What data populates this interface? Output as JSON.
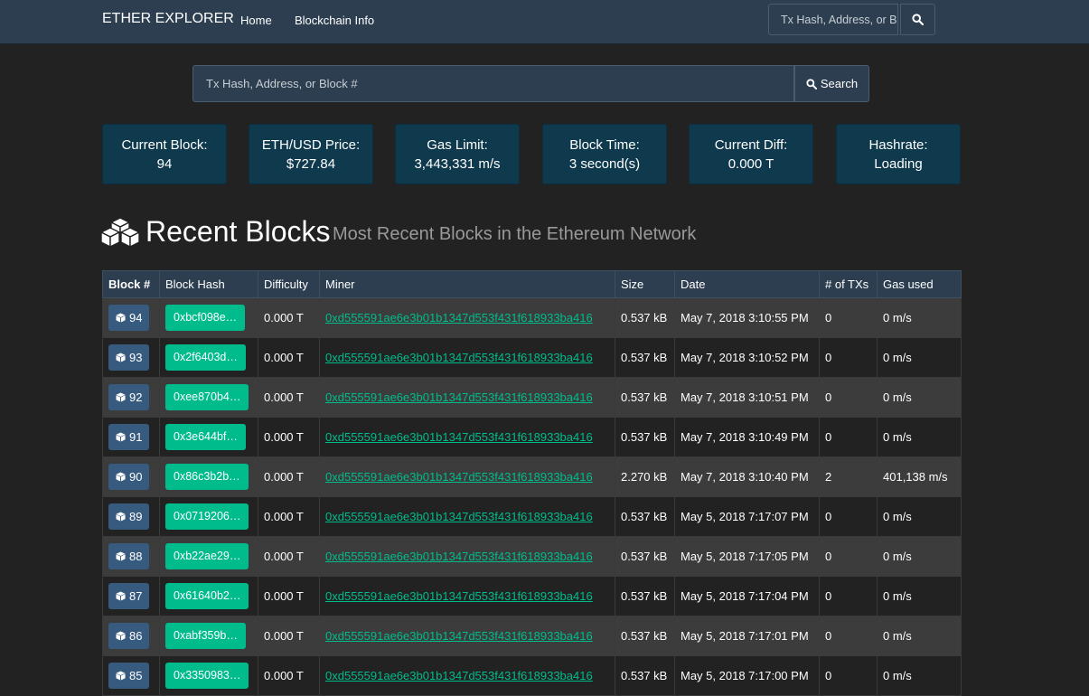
{
  "navbar": {
    "brand": "ETHER EXPLORER",
    "links": [
      "Home",
      "Blockchain Info"
    ],
    "search_placeholder": "Tx Hash, Address, or Block #"
  },
  "search": {
    "placeholder": "Tx Hash, Address, or Block #",
    "button_label": "Search"
  },
  "stats": [
    {
      "label": "Current Block:",
      "value": "94"
    },
    {
      "label": "ETH/USD Price:",
      "value": "$727.84"
    },
    {
      "label": "Gas Limit:",
      "value": "3,443,331 m/s"
    },
    {
      "label": "Block Time:",
      "value": "3 second(s)"
    },
    {
      "label": "Current Diff:",
      "value": "0.000 T"
    },
    {
      "label": "Hashrate:",
      "value": "Loading"
    }
  ],
  "section": {
    "title": "Recent Blocks",
    "subtitle": "Most Recent Blocks in the Ethereum Network"
  },
  "table": {
    "headers": [
      "Block #",
      "Block Hash",
      "Difficulty",
      "Miner",
      "Size",
      "Date",
      "# of TXs",
      "Gas used"
    ],
    "rows": [
      {
        "block": "94",
        "hash": "0xbcf098e…",
        "difficulty": "0.000 T",
        "miner": "0xd555591ae6e3b01b1347d553f431f618933ba416",
        "size": "0.537 kB",
        "date": "May 7, 2018 3:10:55 PM",
        "txs": "0",
        "gas": "0 m/s"
      },
      {
        "block": "93",
        "hash": "0x2f6403d…",
        "difficulty": "0.000 T",
        "miner": "0xd555591ae6e3b01b1347d553f431f618933ba416",
        "size": "0.537 kB",
        "date": "May 7, 2018 3:10:52 PM",
        "txs": "0",
        "gas": "0 m/s"
      },
      {
        "block": "92",
        "hash": "0xee870b4…",
        "difficulty": "0.000 T",
        "miner": "0xd555591ae6e3b01b1347d553f431f618933ba416",
        "size": "0.537 kB",
        "date": "May 7, 2018 3:10:51 PM",
        "txs": "0",
        "gas": "0 m/s"
      },
      {
        "block": "91",
        "hash": "0x3e644bf…",
        "difficulty": "0.000 T",
        "miner": "0xd555591ae6e3b01b1347d553f431f618933ba416",
        "size": "0.537 kB",
        "date": "May 7, 2018 3:10:49 PM",
        "txs": "0",
        "gas": "0 m/s"
      },
      {
        "block": "90",
        "hash": "0x86c3b2b…",
        "difficulty": "0.000 T",
        "miner": "0xd555591ae6e3b01b1347d553f431f618933ba416",
        "size": "2.270 kB",
        "date": "May 7, 2018 3:10:40 PM",
        "txs": "2",
        "gas": "401,138 m/s"
      },
      {
        "block": "89",
        "hash": "0x0719206…",
        "difficulty": "0.000 T",
        "miner": "0xd555591ae6e3b01b1347d553f431f618933ba416",
        "size": "0.537 kB",
        "date": "May 5, 2018 7:17:07 PM",
        "txs": "0",
        "gas": "0 m/s"
      },
      {
        "block": "88",
        "hash": "0xb22ae29…",
        "difficulty": "0.000 T",
        "miner": "0xd555591ae6e3b01b1347d553f431f618933ba416",
        "size": "0.537 kB",
        "date": "May 5, 2018 7:17:05 PM",
        "txs": "0",
        "gas": "0 m/s"
      },
      {
        "block": "87",
        "hash": "0x61640b2…",
        "difficulty": "0.000 T",
        "miner": "0xd555591ae6e3b01b1347d553f431f618933ba416",
        "size": "0.537 kB",
        "date": "May 5, 2018 7:17:04 PM",
        "txs": "0",
        "gas": "0 m/s"
      },
      {
        "block": "86",
        "hash": "0xabf359b…",
        "difficulty": "0.000 T",
        "miner": "0xd555591ae6e3b01b1347d553f431f618933ba416",
        "size": "0.537 kB",
        "date": "May 5, 2018 7:17:01 PM",
        "txs": "0",
        "gas": "0 m/s"
      },
      {
        "block": "85",
        "hash": "0x3350983…",
        "difficulty": "0.000 T",
        "miner": "0xd555591ae6e3b01b1347d553f431f618933ba416",
        "size": "0.537 kB",
        "date": "May 5, 2018 7:17:00 PM",
        "txs": "0",
        "gas": "0 m/s"
      }
    ]
  },
  "colors": {
    "background": "#222222",
    "navbar": "#2c3e50",
    "stat_card": "#0f3a4e",
    "block_button": "#375a7f",
    "hash_button": "#00bc8c",
    "link": "#00bc8c"
  },
  "icons": {
    "search": "search-icon",
    "blocks": "cubes-icon",
    "block": "cube-icon"
  }
}
